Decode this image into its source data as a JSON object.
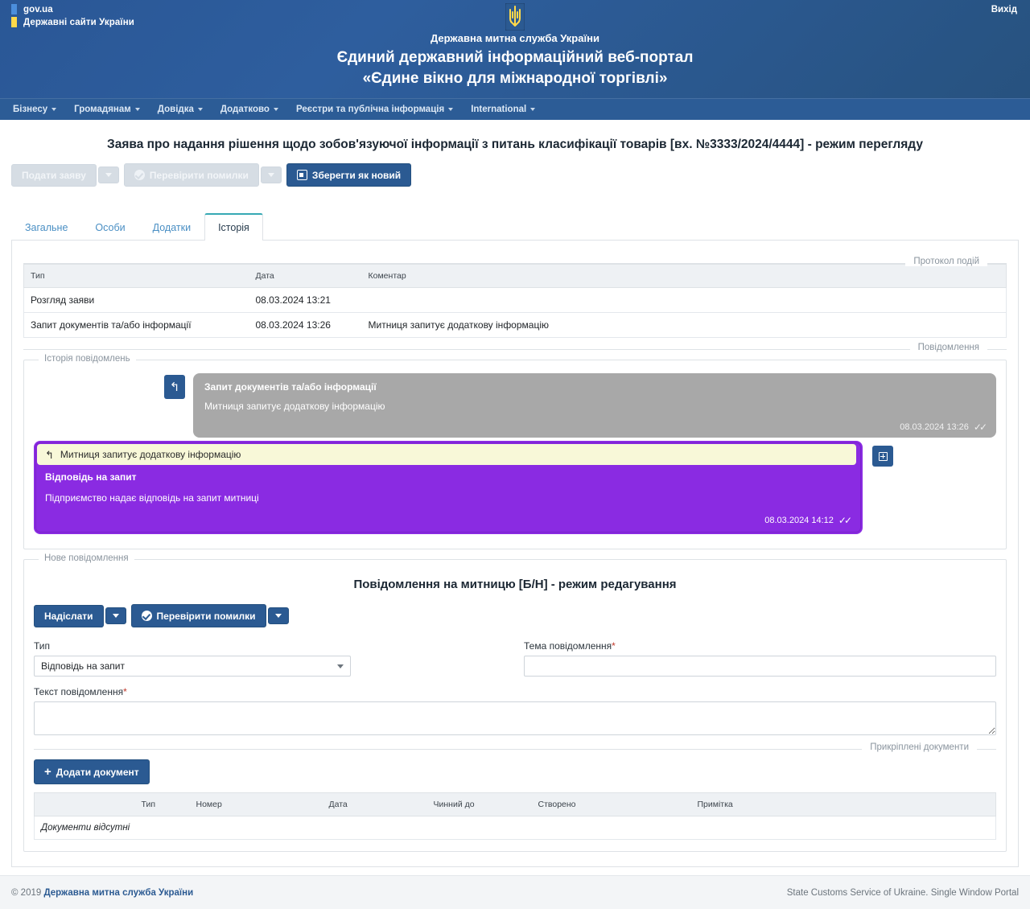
{
  "topbar": {
    "gov_label": "gov.ua",
    "gov_sub": "Державні сайти України",
    "logout": "Вихід",
    "org": "Державна митна служба України",
    "portal_line1": "Єдиний державний інформаційний веб-портал",
    "portal_line2": "«Єдине вікно для міжнародної торгівлі»"
  },
  "nav": {
    "items": [
      {
        "label": "Бізнесу",
        "has_caret": true
      },
      {
        "label": "Громадянам",
        "has_caret": true
      },
      {
        "label": "Довідка",
        "has_caret": true
      },
      {
        "label": "Додатково",
        "has_caret": true
      },
      {
        "label": "Реєстри та публічна інформація",
        "has_caret": true
      },
      {
        "label": "International",
        "has_caret": true
      }
    ]
  },
  "page": {
    "title": "Заява про надання рішення щодо зобов'язуючої інформації з питань класифікації товарів [вх. №3333/2024/4444] - режим перегляду"
  },
  "toolbar": {
    "submit_label": "Подати заяву",
    "check_label": "Перевірити помилки",
    "save_label": "Зберегти як новий"
  },
  "tabs": [
    {
      "label": "Загальне",
      "active": false
    },
    {
      "label": "Особи",
      "active": false
    },
    {
      "label": "Додатки",
      "active": false
    },
    {
      "label": "Історія",
      "active": true
    }
  ],
  "events": {
    "legend": "Протокол подій",
    "columns": [
      "Тип",
      "Дата",
      "Коментар"
    ],
    "rows": [
      {
        "type": "Розгляд заяви",
        "date": "08.03.2024 13:21",
        "comment": ""
      },
      {
        "type": "Запит документів та/або інформації",
        "date": "08.03.2024 13:26",
        "comment": "Митниця запитує додаткову інформацію"
      }
    ]
  },
  "messages": {
    "legend": "Повідомлення",
    "history_legend": "Історія повідомлень",
    "incoming": {
      "title": "Запит документів та/або інформації",
      "body": "Митниця запитує додаткову інформацію",
      "time": "08.03.2024 13:26",
      "ticks": "✓✓"
    },
    "outgoing": {
      "quote": "Митниця запитує додаткову інформацію",
      "title": "Відповідь на запит",
      "body": "Підприємство надає відповідь на запит митниці",
      "time": "08.03.2024 14:12",
      "ticks": "✓✓"
    }
  },
  "new_message": {
    "legend": "Нове повідомлення",
    "heading": "Повідомлення на митницю [Б/Н] - режим редагування",
    "send_label": "Надіслати",
    "check_label": "Перевірити помилки",
    "type_label": "Тип",
    "type_value": "Відповідь на запит",
    "subject_label": "Тема повідомлення",
    "subject_value": "",
    "subject_placeholder": "",
    "text_label": "Текст повідомлення",
    "text_value": "",
    "text_placeholder": ""
  },
  "documents": {
    "legend": "Прикріплені документи",
    "add_label": "Додати документ",
    "columns": [
      "",
      "",
      "Тип",
      "Номер",
      "Дата",
      "Чинний до",
      "Створено",
      "Примітка",
      ""
    ],
    "empty_text": "Документи відсутні"
  },
  "footer": {
    "copyright_prefix": "© 2019 ",
    "copyright_link": "Державна митна служба України",
    "right": "State Customs Service of Ukraine. Single Window Portal"
  },
  "colors": {
    "header_blue": "#2c5c96",
    "primary": "#2b5a92",
    "bubble_out": "#8a2be2",
    "bubble_in": "#a8a8a8",
    "quote_bg": "#f8f8d8",
    "tab_active_border": "#36a9b4"
  }
}
